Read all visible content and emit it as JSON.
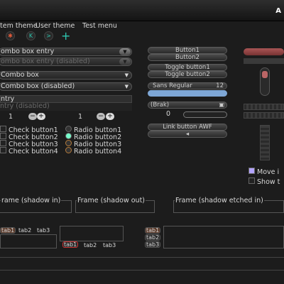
{
  "window": {
    "title": "A"
  },
  "menu": {
    "item1": "tem theme",
    "item2": "User theme",
    "item3": "Test menu"
  },
  "toolbar": {
    "icon1": "gear",
    "icon2": "skip-back",
    "icon3": "skip-forward",
    "icon4": "plus"
  },
  "left": {
    "combo_entry": "ombo box entry",
    "combo_entry_disabled": "ombo box entry (disabled)",
    "combo_box": "Combo box",
    "combo_box_disabled": "Combo box (disabled)",
    "entry": "ntry",
    "entry_disabled": "ntry (disabled)",
    "spin1": "1",
    "spin2": "1",
    "checks": [
      "Check button1",
      "Check button2",
      "Check button3",
      "Check button4"
    ],
    "radios": [
      "Radio button1",
      "Radio button2",
      "Radio button3",
      "Radio button4"
    ]
  },
  "middle": {
    "button1": "Button1",
    "button2": "Button2",
    "toggle1": "Toggle button1",
    "toggle2": "Toggle button2",
    "font_name": "Sans Regular",
    "font_size": "12",
    "combo_brak": "(Brak)",
    "link_button": "Link button AWF",
    "scale_mark": "0"
  },
  "right": {
    "move_label": "Move i",
    "show_label": "Show t"
  },
  "frames": {
    "shadow_in": "rame (shadow in)",
    "shadow_out": "Frame (shadow out)",
    "shadow_etched_in": "Frame (shadow etched in)"
  },
  "tabs": {
    "set1": [
      "tab1",
      "tab2",
      "tab3"
    ],
    "set2": [
      "tab1",
      "tab2",
      "tab3"
    ],
    "set3": [
      "tab1",
      "tab2",
      "tab3"
    ]
  }
}
